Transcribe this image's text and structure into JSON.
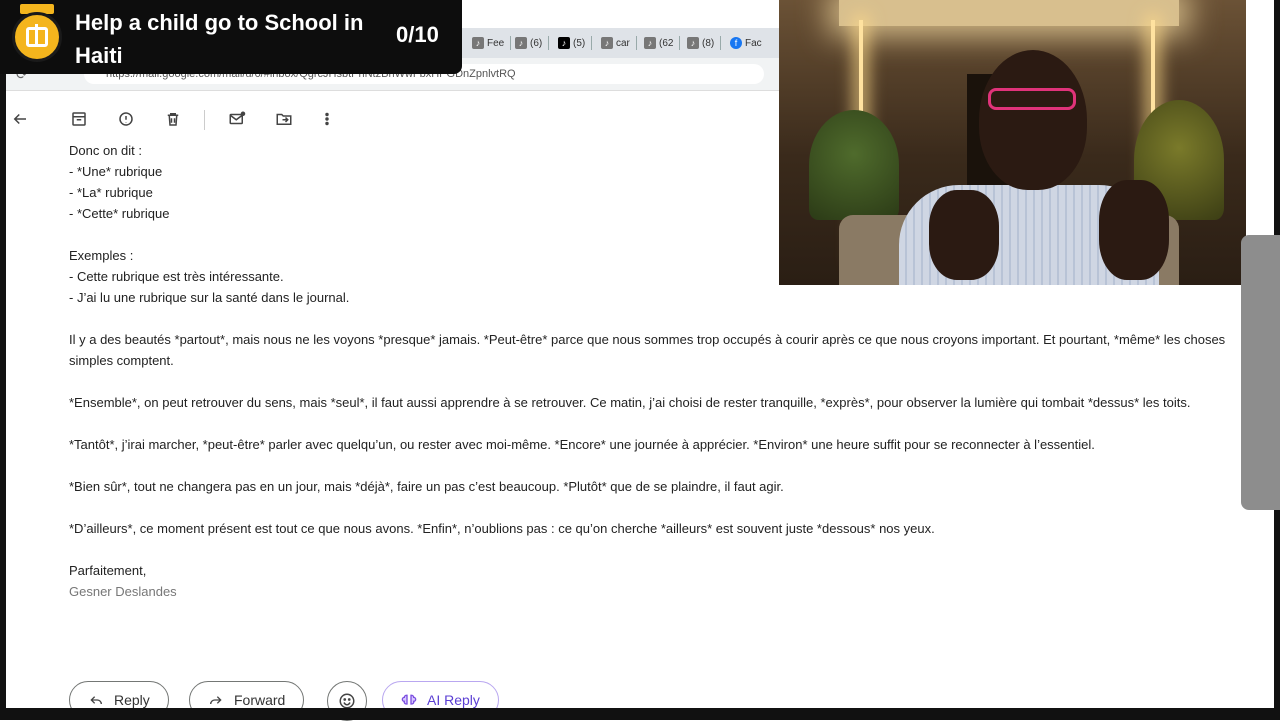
{
  "banner": {
    "title": "Help a child go to School in Haiti",
    "progress": "0/10"
  },
  "tabs": [
    {
      "icon": "tiktok-icon",
      "label": "Fee"
    },
    {
      "icon": "tiktok-icon",
      "label": "(6)"
    },
    {
      "icon": "tiktok-icon",
      "label": "(5)"
    },
    {
      "icon": "tiktok-icon",
      "label": "car"
    },
    {
      "icon": "tiktok-icon",
      "label": "(62"
    },
    {
      "icon": "tiktok-icon",
      "label": "(8)"
    },
    {
      "icon": "facebook-icon",
      "label": "Fac"
    }
  ],
  "address": {
    "url": "https://mail.google.com/mail/u/0/#inbox/QgrcJHsbtPhNtzBnWwFbxHPGDnZpnlvtRQ"
  },
  "email": {
    "intro": "Donc on dit :",
    "list1": [
      "- *Une* rubrique",
      "- *La* rubrique",
      "- *Cette* rubrique"
    ],
    "examples_label": "Exemples :",
    "list2": [
      "- Cette rubrique est très intéressante.",
      "- J’ai lu une rubrique sur la santé dans le journal."
    ],
    "p1": "Il y a des beautés *partout*, mais nous ne les voyons *presque* jamais. *Peut-être* parce que nous sommes trop occupés à courir après ce que nous croyons important. Et pourtant, *même* les choses simples comptent.",
    "p2": "*Ensemble*, on peut retrouver du sens, mais *seul*, il faut aussi apprendre à se retrouver. Ce matin, j’ai choisi de rester tranquille, *exprès*, pour observer la lumière qui tombait *dessus* les toits.",
    "p3": "*Tantôt*, j’irai marcher, *peut-être* parler avec quelqu’un, ou rester avec moi-même. *Encore* une journée à apprécier. *Environ* une heure suffit pour se reconnecter à l’essentiel.",
    "p4": "*Bien sûr*, tout ne changera pas en un jour, mais *déjà*, faire un pas c’est beaucoup. *Plutôt* que de se plaindre, il faut agir.",
    "p5": "*D’ailleurs*, ce moment présent est tout ce que nous avons. *Enfin*, n’oublions pas : ce qu’on cherche *ailleurs* est souvent juste *dessous* nos yeux.",
    "closing": "Parfaitement,",
    "signature": "Gesner Deslandes"
  },
  "actions": {
    "reply": "Reply",
    "forward": "Forward",
    "ai_reply": "AI Reply"
  }
}
